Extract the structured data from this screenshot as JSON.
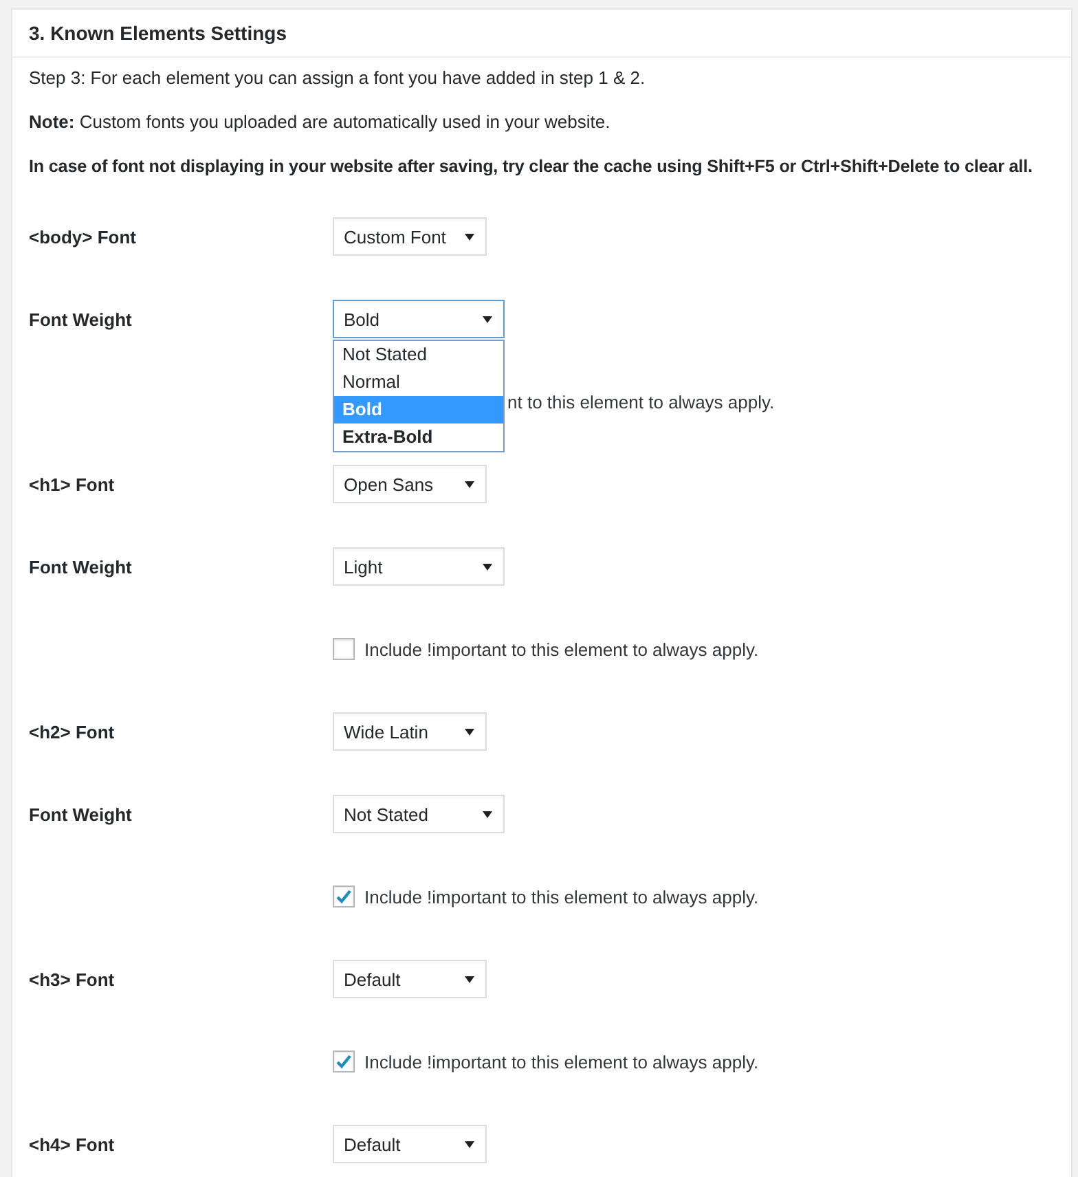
{
  "panel": {
    "title": "3. Known Elements Settings",
    "paragraphs": [
      "Step 3: For each element you can assign a font you have added in step 1 & 2.",
      "**Note:** Custom fonts you uploaded are automatically used in your website.",
      "In case of font not displaying in your website after saving, try clear the cache using Shift+F5 or Ctrl+Shift+Delete to clear all."
    ],
    "rows": [
      {
        "kind": "select",
        "label": "<body> Font",
        "value": "Custom Font",
        "wide": false,
        "focused": false
      },
      {
        "kind": "select",
        "label": "Font Weight",
        "value": "Bold",
        "wide": true,
        "focused": true,
        "options": [
          {
            "label": "Not Stated",
            "bold": false,
            "selected": false
          },
          {
            "label": "Normal",
            "bold": false,
            "selected": false
          },
          {
            "label": "Bold",
            "bold": true,
            "selected": true
          },
          {
            "label": "Extra-Bold",
            "bold": true,
            "selected": false
          }
        ]
      },
      {
        "kind": "covered",
        "text": "nt to this element to always apply."
      },
      {
        "kind": "select",
        "label": "<h1> Font",
        "value": "Open Sans",
        "wide": false,
        "focused": false
      },
      {
        "kind": "select",
        "label": "Font Weight",
        "value": "Light",
        "wide": true,
        "focused": false
      },
      {
        "kind": "checkbox",
        "text": "Include !important to this element to always apply.",
        "checked": false
      },
      {
        "kind": "select",
        "label": "<h2> Font",
        "value": "Wide Latin",
        "wide": false,
        "focused": false
      },
      {
        "kind": "select",
        "label": "Font Weight",
        "value": "Not Stated",
        "wide": true,
        "focused": false
      },
      {
        "kind": "checkbox",
        "text": "Include !important to this element to always apply.",
        "checked": true
      },
      {
        "kind": "select",
        "label": "<h3> Font",
        "value": "Default",
        "wide": false,
        "focused": false
      },
      {
        "kind": "checkbox",
        "text": "Include !important to this element to always apply.",
        "checked": true
      },
      {
        "kind": "select",
        "label": "<h4> Font",
        "value": "Default",
        "wide": false,
        "focused": false
      }
    ]
  }
}
